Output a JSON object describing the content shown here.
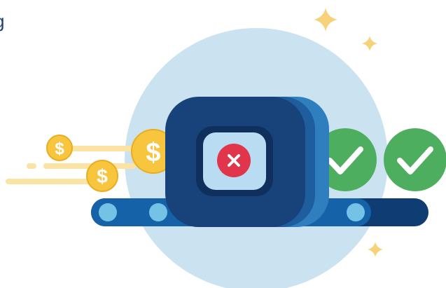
{
  "visible_text_fragment": "g",
  "illustration": {
    "description_items": {
      "coin_symbol": "$",
      "center_symbol": "×"
    },
    "colors": {
      "background_circle": "#cbe3f1",
      "machine_dark": "#17427a",
      "machine_side": "#2f7fbe",
      "belt": "#1662a8",
      "belt_dark": "#0e3c73",
      "roller": "#74c2e6",
      "coin": "#f7c63e",
      "coin_stroke": "#e9ad1f",
      "coin_trail": "#fbe3a4",
      "reject_red": "#e0354a",
      "check_green": "#4eae5f",
      "sparkle": "#f8d27a",
      "window_fill": "#b9dcf2"
    }
  }
}
